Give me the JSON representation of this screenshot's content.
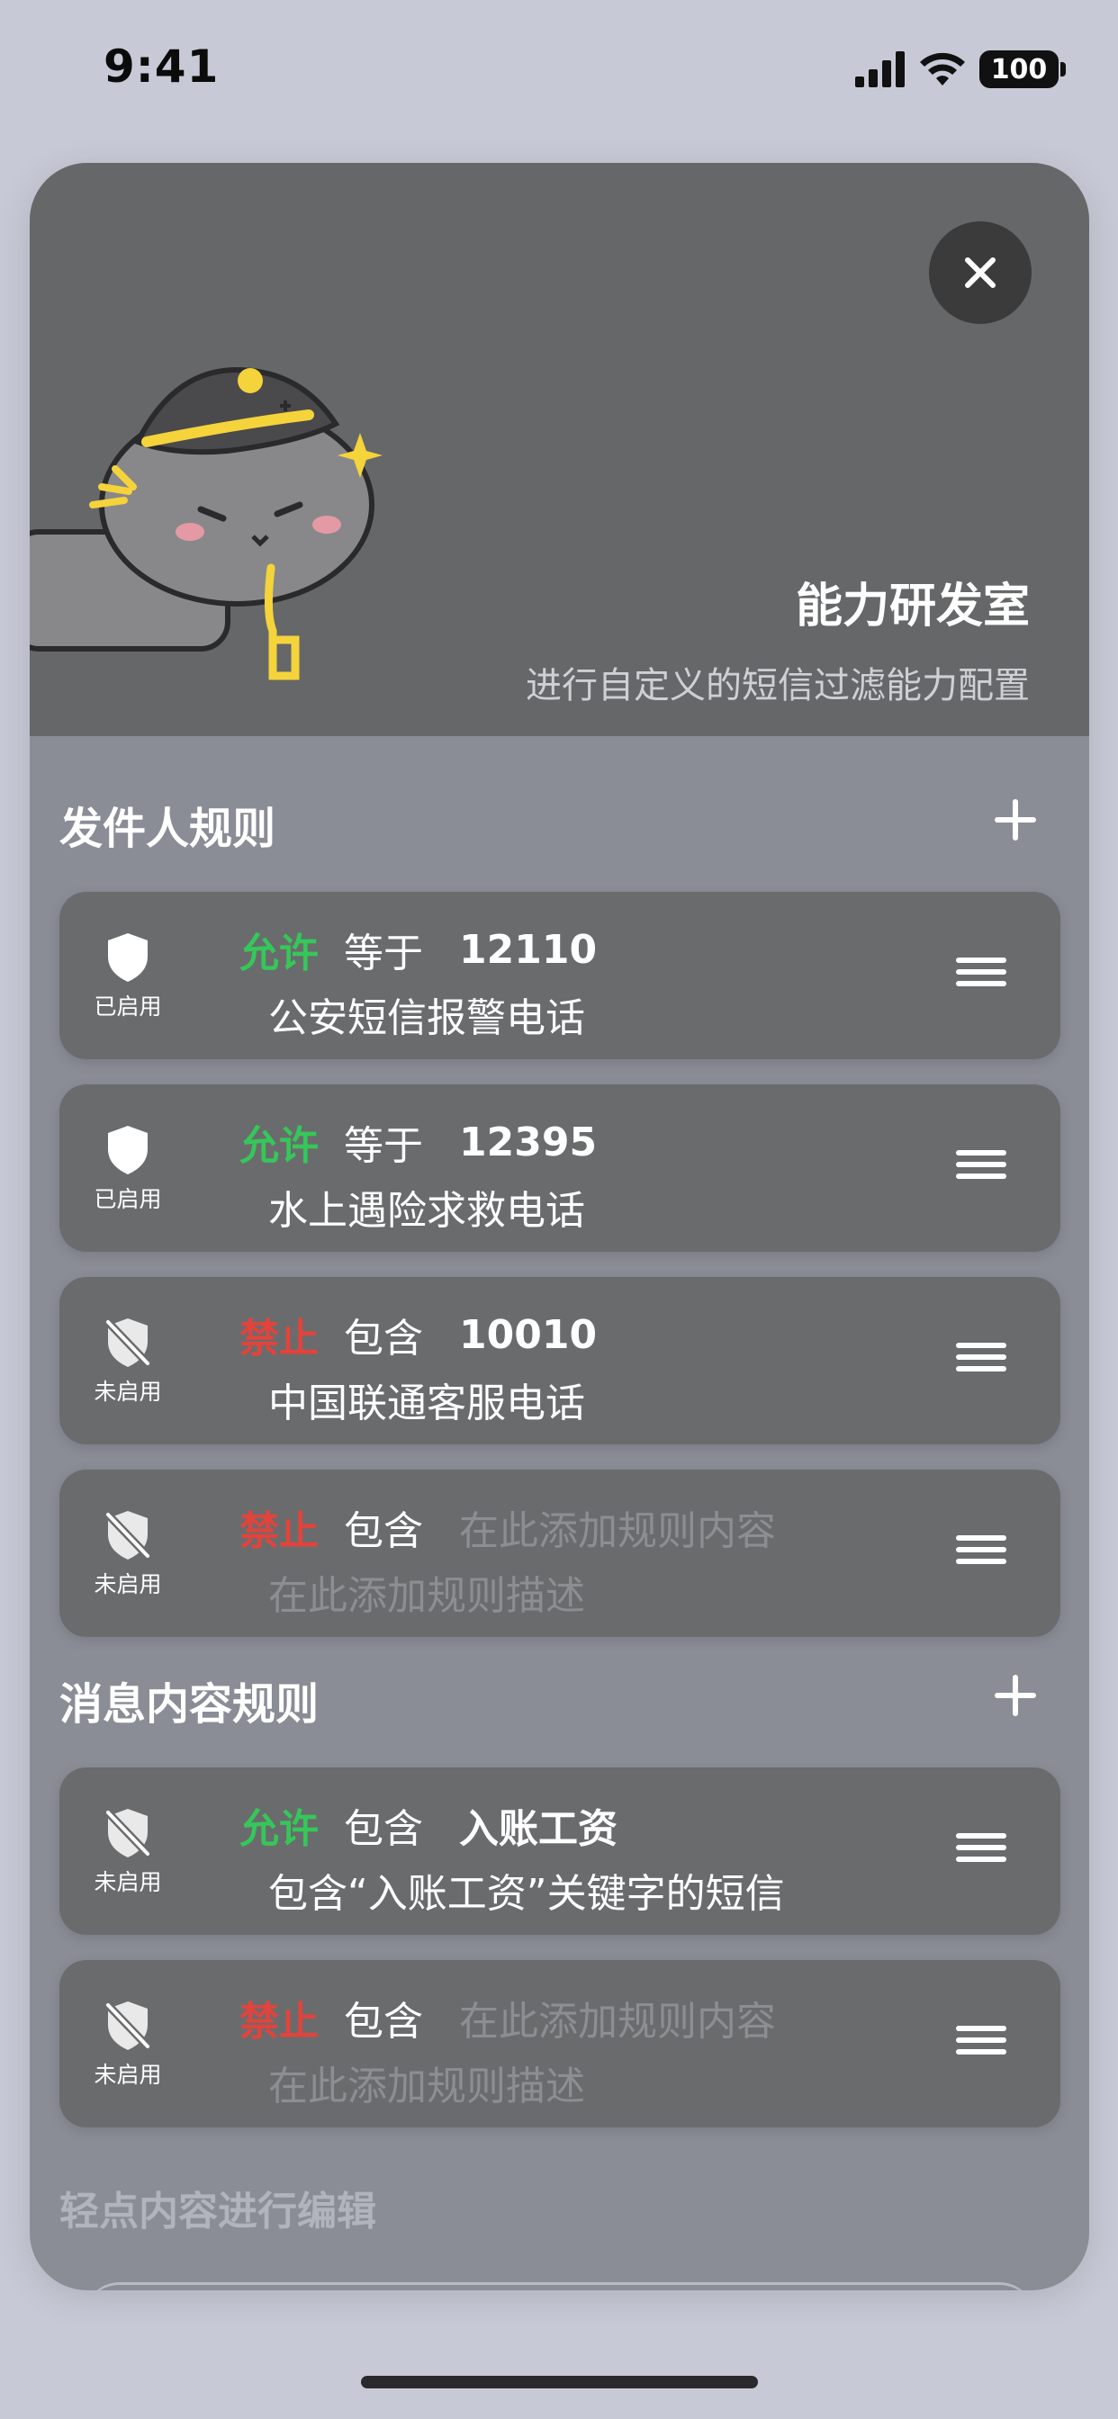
{
  "status_bar": {
    "time": "9:41",
    "battery": "100"
  },
  "banner": {
    "title": "能力研发室",
    "subtitle": "进行自定义的短信过滤能力配置"
  },
  "sections": [
    {
      "title": "发件人规则",
      "rules": [
        {
          "status": "已启用",
          "enabled": true,
          "action": "允许",
          "action_color": "#35c759",
          "match": "等于",
          "value": "12110",
          "value_placeholder": false,
          "description": "公安短信报警电话",
          "description_placeholder": false
        },
        {
          "status": "已启用",
          "enabled": true,
          "action": "允许",
          "action_color": "#35c759",
          "match": "等于",
          "value": "12395",
          "value_placeholder": false,
          "description": "水上遇险求救电话",
          "description_placeholder": false
        },
        {
          "status": "未启用",
          "enabled": false,
          "action": "禁止",
          "action_color": "#e0443c",
          "match": "包含",
          "value": "10010",
          "value_placeholder": false,
          "description": "中国联通客服电话",
          "description_placeholder": false
        },
        {
          "status": "未启用",
          "enabled": false,
          "action": "禁止",
          "action_color": "#e0443c",
          "match": "包含",
          "value": "在此添加规则内容",
          "value_placeholder": true,
          "description": "在此添加规则描述",
          "description_placeholder": true
        }
      ]
    },
    {
      "title": "消息内容规则",
      "rules": [
        {
          "status": "未启用",
          "enabled": false,
          "action": "允许",
          "action_color": "#35c759",
          "match": "包含",
          "value": "入账工资",
          "value_placeholder": false,
          "description": "包含“入账工资”关键字的短信",
          "description_placeholder": false
        },
        {
          "status": "未启用",
          "enabled": false,
          "action": "禁止",
          "action_color": "#e0443c",
          "match": "包含",
          "value": "在此添加规则内容",
          "value_placeholder": true,
          "description": "在此添加规则描述",
          "description_placeholder": true
        }
      ]
    }
  ],
  "footer_hint": "轻点内容进行编辑",
  "icons": {
    "close": "close-icon",
    "add": "plus-icon",
    "enabled": "shield-icon",
    "disabled": "shield-slash-icon",
    "reorder": "drag-handle-icon"
  }
}
